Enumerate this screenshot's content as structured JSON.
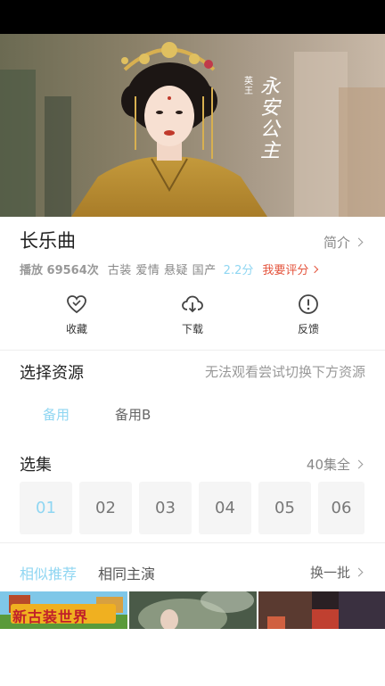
{
  "hero": {
    "caption_small": "英王",
    "caption_big": "永安公主"
  },
  "show": {
    "title": "长乐曲",
    "intro_label": "简介",
    "plays": "播放 69564次",
    "tags": "古装 爱情 悬疑 国产",
    "score": "2.2分",
    "rate_label": "我要评分"
  },
  "actions": [
    {
      "label": "收藏",
      "icon": "heart-icon"
    },
    {
      "label": "下载",
      "icon": "download-cloud-icon"
    },
    {
      "label": "反馈",
      "icon": "feedback-alert-icon"
    }
  ],
  "source": {
    "title": "选择资源",
    "hint": "无法观看尝试切换下方资源",
    "tabs": [
      {
        "label": "备用",
        "active": true
      },
      {
        "label": "备用B",
        "active": false
      }
    ]
  },
  "episodes": {
    "title": "选集",
    "total": "40集全",
    "items": [
      "01",
      "02",
      "03",
      "04",
      "05",
      "06"
    ]
  },
  "recommend": {
    "tabs": [
      "相似推荐",
      "相同主演"
    ],
    "refresh": "换一批",
    "thumb_banner": "新古装世界"
  },
  "colors": {
    "accent": "#8fd6f2",
    "rate": "#e4543d"
  }
}
